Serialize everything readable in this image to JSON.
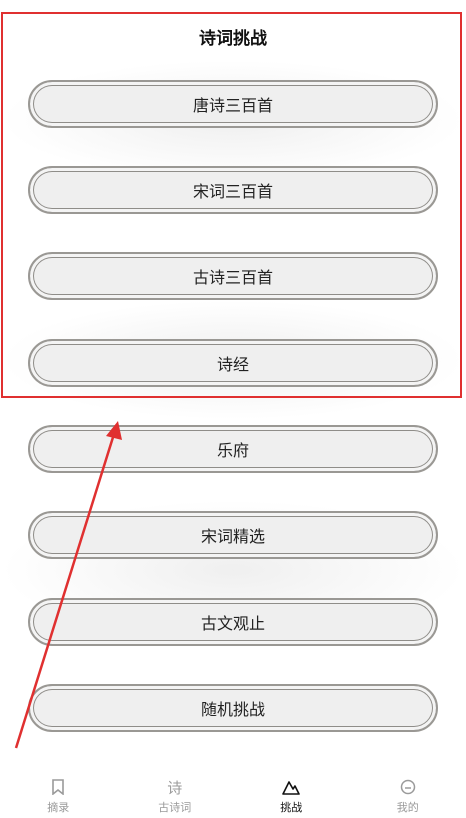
{
  "page_title": "诗词挑战",
  "buttons": [
    {
      "label": "唐诗三百首"
    },
    {
      "label": "宋词三百首"
    },
    {
      "label": "古诗三百首"
    },
    {
      "label": "诗经"
    },
    {
      "label": "乐府"
    },
    {
      "label": "宋词精选"
    },
    {
      "label": "古文观止"
    },
    {
      "label": "随机挑战"
    }
  ],
  "tabbar": {
    "tabs": [
      {
        "label": "摘录",
        "icon": "bookmark-icon",
        "active": false
      },
      {
        "label": "古诗词",
        "icon": "poem-icon",
        "active": false
      },
      {
        "label": "挑战",
        "icon": "mountain-icon",
        "active": true
      },
      {
        "label": "我的",
        "icon": "profile-icon",
        "active": false
      }
    ]
  },
  "annotation": {
    "highlight_color": "#e03030"
  }
}
